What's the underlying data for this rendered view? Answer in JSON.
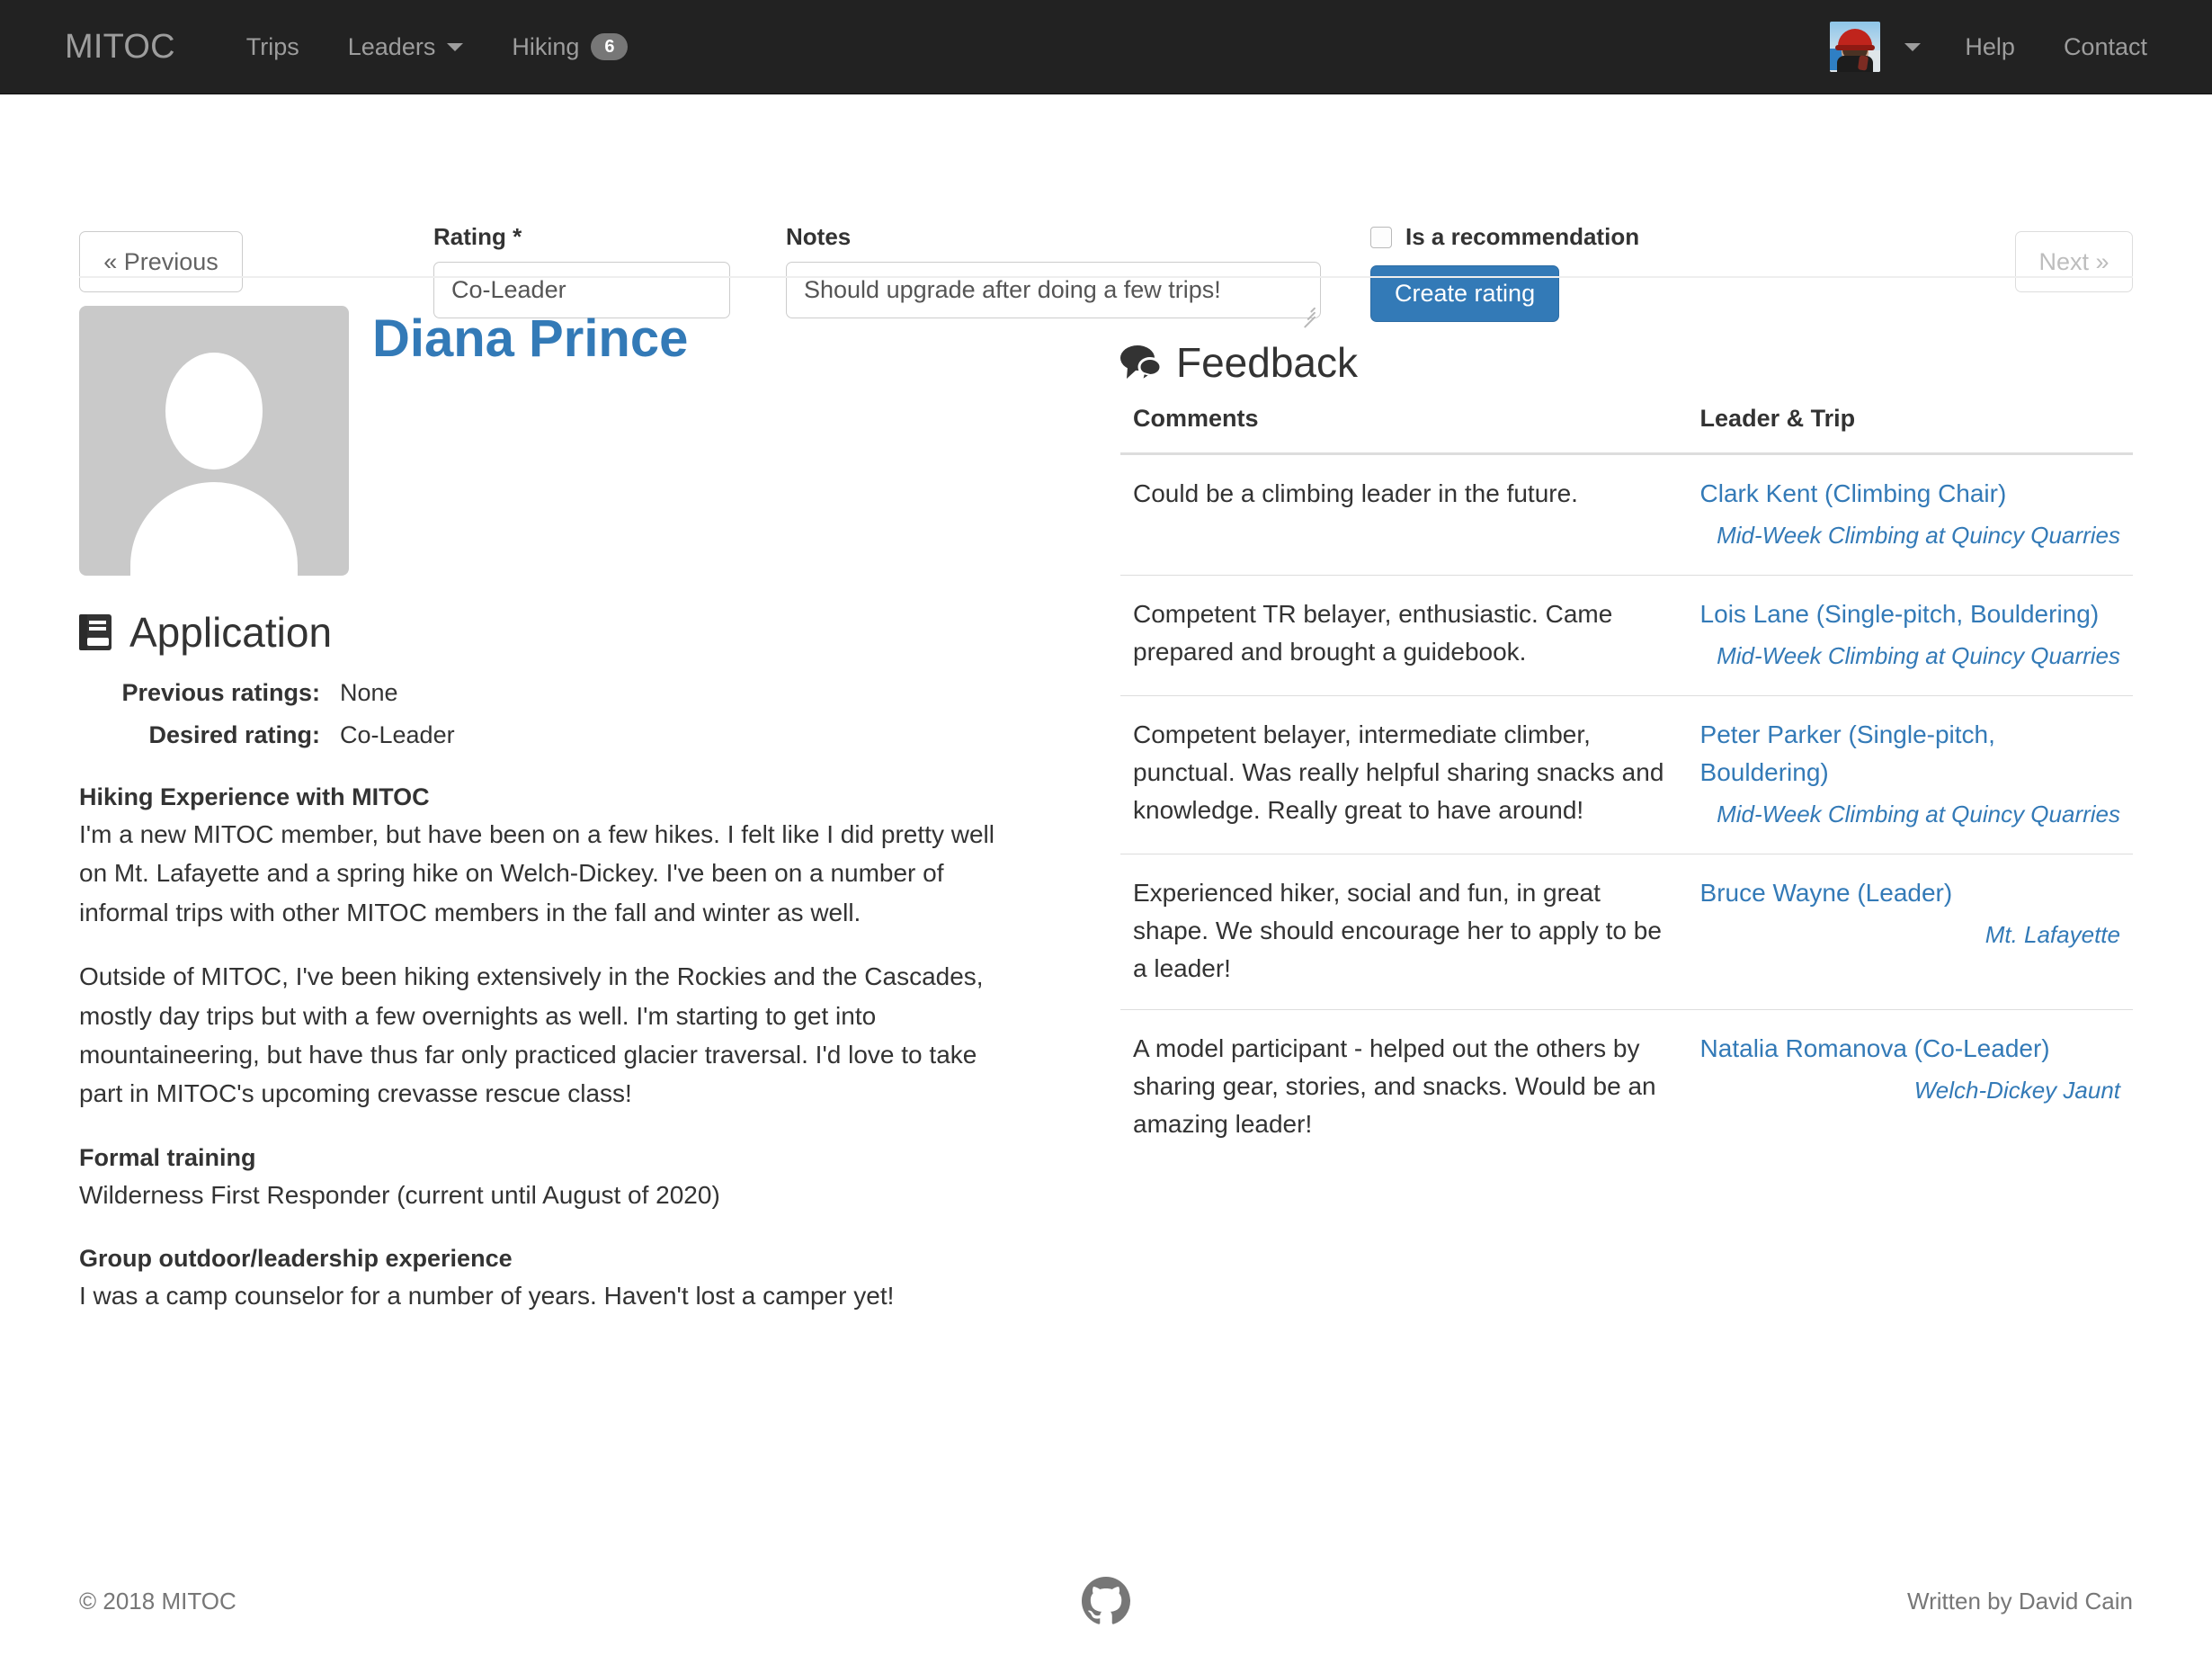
{
  "navbar": {
    "brand": "MITOC",
    "items": [
      {
        "label": "Trips",
        "icon": "",
        "badge": ""
      },
      {
        "label": "Leaders",
        "icon": "chevron-down-icon",
        "badge": ""
      },
      {
        "label": "Hiking",
        "icon": "",
        "badge": "6"
      }
    ],
    "help": "Help",
    "contact": "Contact",
    "avatar_alt": "climber-avatar"
  },
  "form": {
    "previous_label": "« Previous",
    "next_label": "Next »",
    "rating_label": "Rating *",
    "rating_value": "Co-Leader",
    "notes_label": "Notes",
    "notes_value": "Should upgrade after doing a few trips!",
    "recommendation_label": "Is a recommendation",
    "recommendation_checked": false,
    "submit_label": "Create rating",
    "primary_color": "#337ab7"
  },
  "profile": {
    "name": "Diana Prince",
    "name_color": "#337ab7"
  },
  "application": {
    "heading": "Application",
    "heading_icon": "book-icon",
    "previous_ratings_key": "Previous ratings:",
    "previous_ratings_value": "None",
    "desired_rating_key": "Desired rating:",
    "desired_rating_value": "Co-Leader",
    "sections": [
      {
        "heading": "Hiking Experience with MITOC",
        "paragraphs": [
          "I'm a new MITOC member, but have been on a few hikes. I felt like I did pretty well on Mt. Lafayette and a spring hike on Welch-Dickey. I've been on a number of informal trips with other MITOC members in the fall and winter as well.",
          "Outside of MITOC, I've been hiking extensively in the Rockies and the Cascades, mostly day trips but with a few overnights as well. I'm starting to get into mountaineering, but have thus far only practiced glacier traversal. I'd love to take part in MITOC's upcoming crevasse rescue class!"
        ]
      },
      {
        "heading": "Formal training",
        "paragraphs": [
          "Wilderness First Responder (current until August of 2020)"
        ]
      },
      {
        "heading": "Group outdoor/leadership experience",
        "paragraphs": [
          "I was a camp counselor for a number of years. Haven't lost a camper yet!"
        ]
      }
    ]
  },
  "feedback": {
    "heading": "Feedback",
    "heading_icon": "comments-icon",
    "columns": {
      "comments": "Comments",
      "leader_trip": "Leader & Trip"
    },
    "rows": [
      {
        "comment": "Could be a climbing leader in the future.",
        "leader": "Clark Kent (Climbing Chair)",
        "trip": "Mid-Week Climbing at Quincy Quarries"
      },
      {
        "comment": "Competent TR belayer, enthusiastic. Came prepared and brought a guidebook.",
        "leader": "Lois Lane (Single-pitch, Bouldering)",
        "trip": "Mid-Week Climbing at Quincy Quarries"
      },
      {
        "comment": "Competent belayer, intermediate climber, punctual. Was really helpful sharing snacks and knowledge. Really great to have around!",
        "leader": "Peter Parker (Single-pitch, Bouldering)",
        "trip": "Mid-Week Climbing at Quincy Quarries"
      },
      {
        "comment": "Experienced hiker, social and fun, in great shape. We should encourage her to apply to be a leader!",
        "leader": "Bruce Wayne (Leader)",
        "trip": "Mt. Lafayette"
      },
      {
        "comment": "A model participant - helped out the others by sharing gear, stories, and snacks. Would be an amazing leader!",
        "leader": "Natalia Romanova (Co-Leader)",
        "trip": "Welch-Dickey Jaunt"
      }
    ]
  },
  "footer": {
    "copyright": "© 2018 MITOC",
    "author": "Written by David Cain",
    "github_icon": "github-icon"
  }
}
